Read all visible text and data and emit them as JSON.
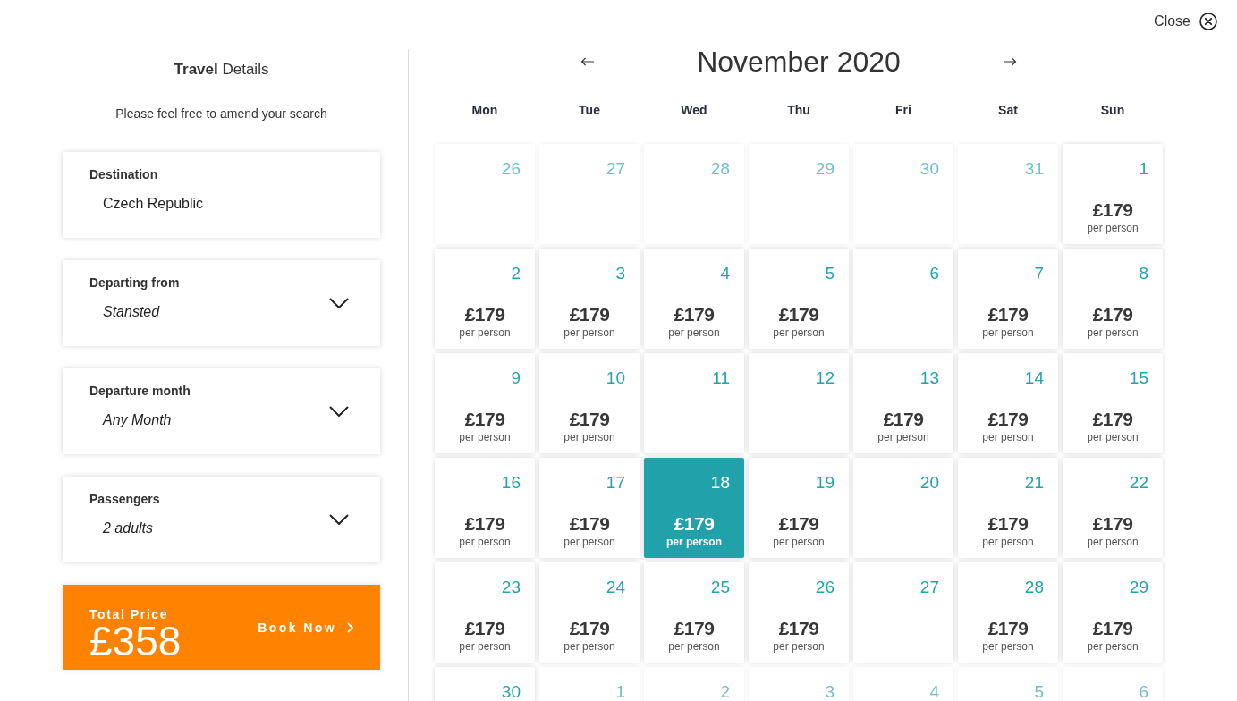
{
  "close_button": {
    "label": "Close"
  },
  "travel_details": {
    "title": "**Travel** Details",
    "subtitle": "Please feel free to amend your search",
    "fields": [
      {
        "kind": "text",
        "label": "Destination",
        "value": "Czech Republic"
      },
      {
        "kind": "dropdown",
        "label": "Departing from",
        "value": "Stansted"
      },
      {
        "kind": "dropdown",
        "label": "Departure month",
        "value": "Any Month"
      },
      {
        "kind": "dropdown",
        "label": "Passengers",
        "value": "2 adults"
      }
    ],
    "total": {
      "label": "Total Price",
      "amount": "£358",
      "action": "Book Now"
    }
  },
  "calendar": {
    "month": "November 2020",
    "weekdays": [
      "Mon",
      "Tue",
      "Wed",
      "Thu",
      "Fri",
      "Sat",
      "Sun"
    ],
    "weeks": [
      [
        {
          "date": "26",
          "in_month": false,
          "selected": false
        },
        {
          "date": "27",
          "in_month": false,
          "selected": false
        },
        {
          "date": "28",
          "in_month": false,
          "selected": false
        },
        {
          "date": "29",
          "in_month": false,
          "selected": false
        },
        {
          "date": "30",
          "in_month": false,
          "selected": false
        },
        {
          "date": "31",
          "in_month": false,
          "selected": false
        },
        {
          "date": "1",
          "in_month": true,
          "selected": false,
          "price": "£179",
          "price_note": "per person"
        }
      ],
      [
        {
          "date": "2",
          "in_month": true,
          "selected": false,
          "price": "£179",
          "price_note": "per person"
        },
        {
          "date": "3",
          "in_month": true,
          "selected": false,
          "price": "£179",
          "price_note": "per person"
        },
        {
          "date": "4",
          "in_month": true,
          "selected": false,
          "price": "£179",
          "price_note": "per person"
        },
        {
          "date": "5",
          "in_month": true,
          "selected": false,
          "price": "£179",
          "price_note": "per person"
        },
        {
          "date": "6",
          "in_month": true,
          "selected": false
        },
        {
          "date": "7",
          "in_month": true,
          "selected": false,
          "price": "£179",
          "price_note": "per person"
        },
        {
          "date": "8",
          "in_month": true,
          "selected": false,
          "price": "£179",
          "price_note": "per person"
        }
      ],
      [
        {
          "date": "9",
          "in_month": true,
          "selected": false,
          "price": "£179",
          "price_note": "per person"
        },
        {
          "date": "10",
          "in_month": true,
          "selected": false,
          "price": "£179",
          "price_note": "per person"
        },
        {
          "date": "11",
          "in_month": true,
          "selected": false
        },
        {
          "date": "12",
          "in_month": true,
          "selected": false
        },
        {
          "date": "13",
          "in_month": true,
          "selected": false,
          "price": "£179",
          "price_note": "per person"
        },
        {
          "date": "14",
          "in_month": true,
          "selected": false,
          "price": "£179",
          "price_note": "per person"
        },
        {
          "date": "15",
          "in_month": true,
          "selected": false,
          "price": "£179",
          "price_note": "per person"
        }
      ],
      [
        {
          "date": "16",
          "in_month": true,
          "selected": false,
          "price": "£179",
          "price_note": "per person"
        },
        {
          "date": "17",
          "in_month": true,
          "selected": false,
          "price": "£179",
          "price_note": "per person"
        },
        {
          "date": "18",
          "in_month": true,
          "selected": true,
          "price": "£179",
          "price_note": "per person"
        },
        {
          "date": "19",
          "in_month": true,
          "selected": false,
          "price": "£179",
          "price_note": "per person"
        },
        {
          "date": "20",
          "in_month": true,
          "selected": false
        },
        {
          "date": "21",
          "in_month": true,
          "selected": false,
          "price": "£179",
          "price_note": "per person"
        },
        {
          "date": "22",
          "in_month": true,
          "selected": false,
          "price": "£179",
          "price_note": "per person"
        }
      ],
      [
        {
          "date": "23",
          "in_month": true,
          "selected": false,
          "price": "£179",
          "price_note": "per person"
        },
        {
          "date": "24",
          "in_month": true,
          "selected": false,
          "price": "£179",
          "price_note": "per person"
        },
        {
          "date": "25",
          "in_month": true,
          "selected": false,
          "price": "£179",
          "price_note": "per person"
        },
        {
          "date": "26",
          "in_month": true,
          "selected": false,
          "price": "£179",
          "price_note": "per person"
        },
        {
          "date": "27",
          "in_month": true,
          "selected": false
        },
        {
          "date": "28",
          "in_month": true,
          "selected": false,
          "price": "£179",
          "price_note": "per person"
        },
        {
          "date": "29",
          "in_month": true,
          "selected": false,
          "price": "£179",
          "price_note": "per person"
        }
      ],
      [
        {
          "date": "30",
          "in_month": true,
          "selected": false
        },
        {
          "date": "1",
          "in_month": false,
          "selected": false
        },
        {
          "date": "2",
          "in_month": false,
          "selected": false
        },
        {
          "date": "3",
          "in_month": false,
          "selected": false
        },
        {
          "date": "4",
          "in_month": false,
          "selected": false
        },
        {
          "date": "5",
          "in_month": false,
          "selected": false
        },
        {
          "date": "6",
          "in_month": false,
          "selected": false
        }
      ]
    ]
  }
}
